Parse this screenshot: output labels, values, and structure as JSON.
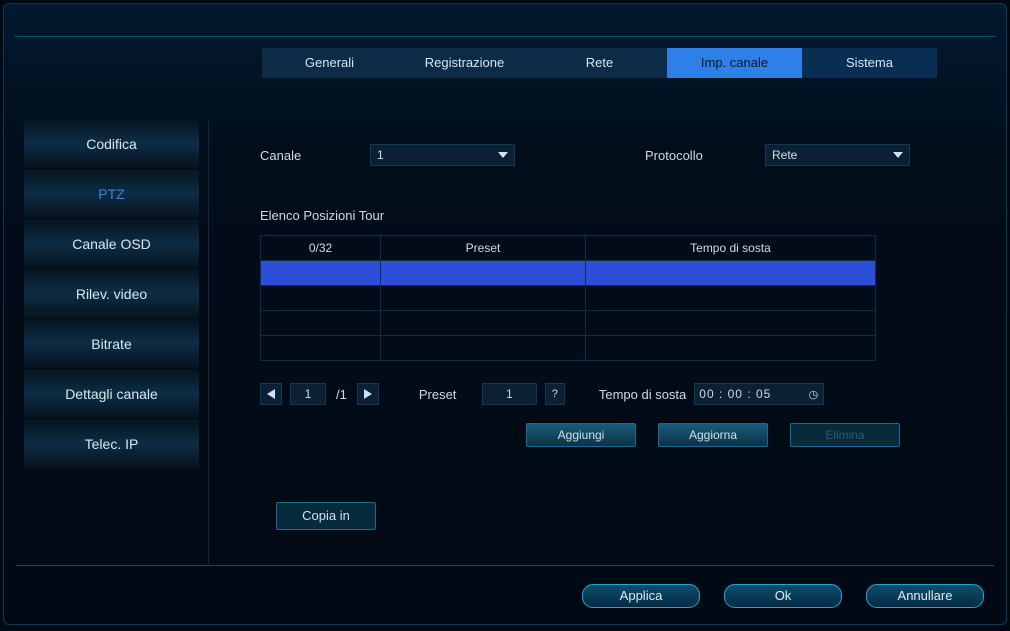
{
  "tabs": {
    "generali": "Generali",
    "registrazione": "Registrazione",
    "rete": "Rete",
    "imp_canale": "Imp. canale",
    "sistema": "Sistema"
  },
  "sidebar": {
    "items": [
      "Codifica",
      "PTZ",
      "Canale OSD",
      "Rilev. video",
      "Bitrate",
      "Dettagli canale",
      "Telec. IP"
    ]
  },
  "form": {
    "canale_label": "Canale",
    "canale_value": "1",
    "protocollo_label": "Protocollo",
    "protocollo_value": "Rete",
    "section_title": "Elenco Posizioni Tour",
    "table": {
      "col1": "0/32",
      "col2": "Preset",
      "col3": "Tempo di sosta"
    },
    "page_value": "1",
    "page_total": "/1",
    "preset_label": "Preset",
    "preset_value": "1",
    "preset_help": "?",
    "dwell_label": "Tempo di sosta",
    "dwell_value": "00 : 00 : 05",
    "btn_add": "Aggiungi",
    "btn_update": "Aggiorna",
    "btn_delete": "Elimina",
    "btn_copy": "Copia in"
  },
  "footer": {
    "apply": "Applica",
    "ok": "Ok",
    "cancel": "Annullare"
  }
}
